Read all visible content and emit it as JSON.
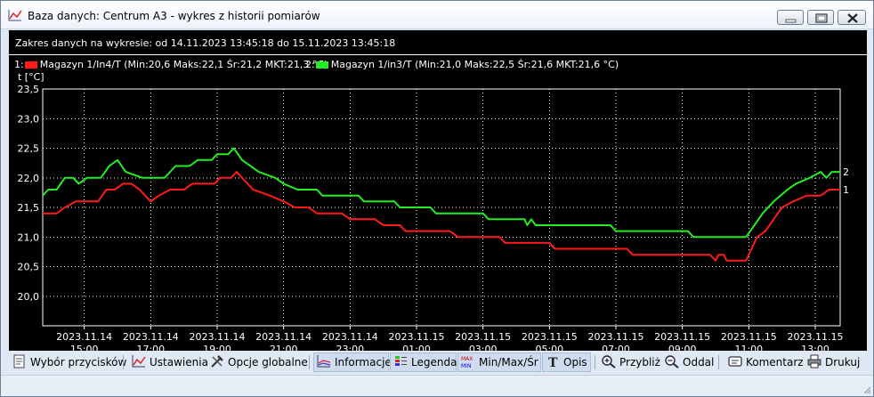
{
  "window": {
    "title": "Baza danych: Centrum A3 - wykres z historii pomiarów"
  },
  "chart_header": {
    "range_text": "Zakres danych na wykresie: od 14.11.2023 13:45:18 do 15.11.2023 13:45:18"
  },
  "legend": [
    {
      "prefix": "1:",
      "label": "Magazyn 1/In4/T (Min:20,6 Maks:22,1 Śr:21,2 MKT:21,3 °C)",
      "color": "#ff1a1a"
    },
    {
      "prefix": "2:",
      "label": "Magazyn 1/in3/T (Min:21,0 Maks:22,5 Śr:21,6 MKT:21,6 °C)",
      "color": "#22ee22"
    }
  ],
  "toolbar": {
    "buttons": [
      {
        "name": "wybor-przyciskow",
        "label": "Wybór przycisków",
        "icon": "page-icon"
      },
      {
        "name": "ustawienia",
        "label": "Ustawienia",
        "icon": "chart-icon"
      },
      {
        "name": "opcje-globalne",
        "label": "Opcje globalne",
        "icon": "tools-icon"
      },
      {
        "name": "informacje",
        "label": "Informacje",
        "icon": "info-chart-icon"
      },
      {
        "name": "legenda",
        "label": "Legenda",
        "icon": "legend-icon"
      },
      {
        "name": "min-max-sr",
        "label": "Min/Max/Śr",
        "icon": "maxmin-icon"
      },
      {
        "name": "opis",
        "label": "Opis",
        "icon": "text-icon"
      },
      {
        "name": "przybliz",
        "label": "Przybliż",
        "icon": "zoom-in-icon"
      },
      {
        "name": "oddal",
        "label": "Oddal",
        "icon": "zoom-out-icon"
      },
      {
        "name": "komentarz",
        "label": "Komentarz",
        "icon": "comment-icon"
      },
      {
        "name": "drukuj",
        "label": "Drukuj",
        "icon": "printer-icon"
      }
    ],
    "active": [
      "informacje",
      "legenda",
      "min-max-sr",
      "opis"
    ]
  },
  "chart_data": {
    "type": "line",
    "ylabel": "t [°C]",
    "ylim": [
      19.5,
      23.5
    ],
    "yticks": [
      "23,5",
      "23,0",
      "22,5",
      "22,0",
      "21,5",
      "21,0",
      "20,5",
      "20,0"
    ],
    "ytick_values": [
      23.5,
      23.0,
      22.5,
      22.0,
      21.5,
      21.0,
      20.5,
      20.0
    ],
    "xlim": [
      "2023-11-14T13:45",
      "2023-11-15T13:45"
    ],
    "xticks": [
      {
        "time": "2023-11-14T15:00",
        "date": "2023.11.14",
        "hour": "15:00"
      },
      {
        "time": "2023-11-14T17:00",
        "date": "2023.11.14",
        "hour": "17:00"
      },
      {
        "time": "2023-11-14T19:00",
        "date": "2023.11.14",
        "hour": "19:00"
      },
      {
        "time": "2023-11-14T21:00",
        "date": "2023.11.14",
        "hour": "21:00"
      },
      {
        "time": "2023-11-14T23:00",
        "date": "2023.11.14",
        "hour": "23:00"
      },
      {
        "time": "2023-11-15T01:00",
        "date": "2023.11.15",
        "hour": "01:00"
      },
      {
        "time": "2023-11-15T03:00",
        "date": "2023.11.15",
        "hour": "03:00"
      },
      {
        "time": "2023-11-15T05:00",
        "date": "2023.11.15",
        "hour": "05:00"
      },
      {
        "time": "2023-11-15T07:00",
        "date": "2023.11.15",
        "hour": "07:00"
      },
      {
        "time": "2023-11-15T09:00",
        "date": "2023.11.15",
        "hour": "09:00"
      },
      {
        "time": "2023-11-15T11:00",
        "date": "2023.11.15",
        "hour": "11:00"
      },
      {
        "time": "2023-11-15T13:00",
        "date": "2023.11.15",
        "hour": "13:00"
      }
    ],
    "series": [
      {
        "name": "Magazyn 1/In4/T",
        "end_label": "1",
        "color": "#ff1a1a",
        "points": [
          [
            "2023-11-14T13:45",
            21.4
          ],
          [
            "2023-11-14T14:10",
            21.4
          ],
          [
            "2023-11-14T14:25",
            21.5
          ],
          [
            "2023-11-14T14:45",
            21.6
          ],
          [
            "2023-11-14T15:25",
            21.6
          ],
          [
            "2023-11-14T15:40",
            21.8
          ],
          [
            "2023-11-14T15:55",
            21.8
          ],
          [
            "2023-11-14T16:10",
            21.9
          ],
          [
            "2023-11-14T16:25",
            21.9
          ],
          [
            "2023-11-14T16:40",
            21.8
          ],
          [
            "2023-11-14T16:50",
            21.7
          ],
          [
            "2023-11-14T17:00",
            21.6
          ],
          [
            "2023-11-14T17:15",
            21.7
          ],
          [
            "2023-11-14T17:35",
            21.8
          ],
          [
            "2023-11-14T18:00",
            21.8
          ],
          [
            "2023-11-14T18:15",
            21.9
          ],
          [
            "2023-11-14T18:55",
            21.9
          ],
          [
            "2023-11-14T19:05",
            22.0
          ],
          [
            "2023-11-14T19:25",
            22.0
          ],
          [
            "2023-11-14T19:35",
            22.1
          ],
          [
            "2023-11-14T19:45",
            22.0
          ],
          [
            "2023-11-14T20:05",
            21.8
          ],
          [
            "2023-11-14T20:35",
            21.7
          ],
          [
            "2023-11-14T21:00",
            21.6
          ],
          [
            "2023-11-14T21:20",
            21.5
          ],
          [
            "2023-11-14T21:45",
            21.5
          ],
          [
            "2023-11-14T22:00",
            21.4
          ],
          [
            "2023-11-14T22:45",
            21.4
          ],
          [
            "2023-11-14T23:00",
            21.3
          ],
          [
            "2023-11-14T23:45",
            21.3
          ],
          [
            "2023-11-15T00:00",
            21.2
          ],
          [
            "2023-11-15T00:30",
            21.2
          ],
          [
            "2023-11-15T00:40",
            21.1
          ],
          [
            "2023-11-15T02:00",
            21.1
          ],
          [
            "2023-11-15T02:15",
            21.0
          ],
          [
            "2023-11-15T03:30",
            21.0
          ],
          [
            "2023-11-15T03:40",
            20.9
          ],
          [
            "2023-11-15T05:00",
            20.9
          ],
          [
            "2023-11-15T05:10",
            20.8
          ],
          [
            "2023-11-15T07:20",
            20.8
          ],
          [
            "2023-11-15T07:30",
            20.7
          ],
          [
            "2023-11-15T09:50",
            20.7
          ],
          [
            "2023-11-15T10:00",
            20.6
          ],
          [
            "2023-11-15T10:05",
            20.7
          ],
          [
            "2023-11-15T10:15",
            20.7
          ],
          [
            "2023-11-15T10:20",
            20.6
          ],
          [
            "2023-11-15T10:55",
            20.6
          ],
          [
            "2023-11-15T11:05",
            20.8
          ],
          [
            "2023-11-15T11:15",
            21.0
          ],
          [
            "2023-11-15T11:30",
            21.1
          ],
          [
            "2023-11-15T11:45",
            21.3
          ],
          [
            "2023-11-15T12:00",
            21.5
          ],
          [
            "2023-11-15T12:20",
            21.6
          ],
          [
            "2023-11-15T12:45",
            21.7
          ],
          [
            "2023-11-15T13:10",
            21.7
          ],
          [
            "2023-11-15T13:25",
            21.8
          ],
          [
            "2023-11-15T13:45",
            21.8
          ]
        ]
      },
      {
        "name": "Magazyn 1/in3/T",
        "end_label": "2",
        "color": "#22ee22",
        "points": [
          [
            "2023-11-14T13:45",
            21.7
          ],
          [
            "2023-11-14T13:55",
            21.8
          ],
          [
            "2023-11-14T14:10",
            21.8
          ],
          [
            "2023-11-14T14:25",
            22.0
          ],
          [
            "2023-11-14T14:40",
            22.0
          ],
          [
            "2023-11-14T14:50",
            21.9
          ],
          [
            "2023-11-14T15:05",
            22.0
          ],
          [
            "2023-11-14T15:30",
            22.0
          ],
          [
            "2023-11-14T15:45",
            22.2
          ],
          [
            "2023-11-14T16:00",
            22.3
          ],
          [
            "2023-11-14T16:15",
            22.1
          ],
          [
            "2023-11-14T16:45",
            22.0
          ],
          [
            "2023-11-14T17:25",
            22.0
          ],
          [
            "2023-11-14T17:45",
            22.2
          ],
          [
            "2023-11-14T18:10",
            22.2
          ],
          [
            "2023-11-14T18:25",
            22.3
          ],
          [
            "2023-11-14T18:50",
            22.3
          ],
          [
            "2023-11-14T19:00",
            22.4
          ],
          [
            "2023-11-14T19:20",
            22.4
          ],
          [
            "2023-11-14T19:30",
            22.5
          ],
          [
            "2023-11-14T19:45",
            22.3
          ],
          [
            "2023-11-14T20:15",
            22.1
          ],
          [
            "2023-11-14T20:45",
            22.0
          ],
          [
            "2023-11-14T21:00",
            21.9
          ],
          [
            "2023-11-14T21:25",
            21.8
          ],
          [
            "2023-11-14T22:00",
            21.8
          ],
          [
            "2023-11-14T22:10",
            21.7
          ],
          [
            "2023-11-14T23:15",
            21.7
          ],
          [
            "2023-11-14T23:25",
            21.6
          ],
          [
            "2023-11-15T00:20",
            21.6
          ],
          [
            "2023-11-15T00:30",
            21.5
          ],
          [
            "2023-11-15T01:25",
            21.5
          ],
          [
            "2023-11-15T01:35",
            21.4
          ],
          [
            "2023-11-15T03:00",
            21.4
          ],
          [
            "2023-11-15T03:10",
            21.3
          ],
          [
            "2023-11-15T04:15",
            21.3
          ],
          [
            "2023-11-15T04:20",
            21.2
          ],
          [
            "2023-11-15T04:27",
            21.3
          ],
          [
            "2023-11-15T04:35",
            21.2
          ],
          [
            "2023-11-15T06:50",
            21.2
          ],
          [
            "2023-11-15T07:00",
            21.1
          ],
          [
            "2023-11-15T09:10",
            21.1
          ],
          [
            "2023-11-15T09:20",
            21.0
          ],
          [
            "2023-11-15T10:55",
            21.0
          ],
          [
            "2023-11-15T11:10",
            21.2
          ],
          [
            "2023-11-15T11:25",
            21.4
          ],
          [
            "2023-11-15T11:45",
            21.6
          ],
          [
            "2023-11-15T12:10",
            21.8
          ],
          [
            "2023-11-15T12:25",
            21.9
          ],
          [
            "2023-11-15T12:50",
            22.0
          ],
          [
            "2023-11-15T13:10",
            22.1
          ],
          [
            "2023-11-15T13:20",
            22.0
          ],
          [
            "2023-11-15T13:30",
            22.1
          ],
          [
            "2023-11-15T13:45",
            22.1
          ]
        ]
      }
    ]
  }
}
